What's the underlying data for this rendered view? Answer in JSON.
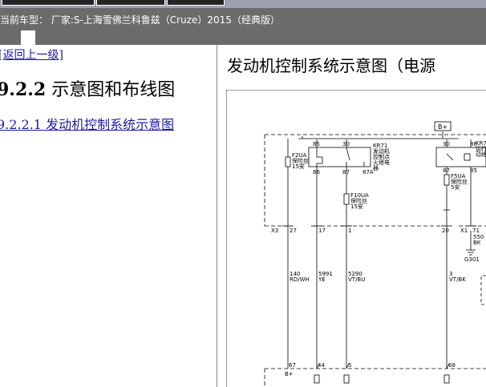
{
  "window": {
    "breadcrumb": "当前车型：  厂家:S-上海雪佛兰科鲁兹（Cruze）2015（经典版）"
  },
  "left": {
    "back_link": "[返回上一级]",
    "section_number": "9.2.2",
    "section_title": "示意图和布线图",
    "sub_link": "9.2.2.1 发动机控制系统示意图"
  },
  "doc": {
    "title": "发动机控制系统示意图（电源"
  },
  "diagram": {
    "bplus_top": "B+",
    "relay1": {
      "l1": "KR71",
      "l2": "发动机",
      "l3": "控制点",
      "l4": "火继电",
      "l5": "器"
    },
    "relay1_pins": {
      "p85": "85",
      "p30": "30",
      "p86": "86",
      "p87": "87",
      "p87a": "87A"
    },
    "fuse1": {
      "l1": "F2UA",
      "l2": "保险丝",
      "l3": "15安"
    },
    "fuse2": {
      "l1": "F10UA",
      "l2": "保险丝",
      "l3": "15安"
    },
    "fuse3": {
      "l1": "F5UA",
      "l2": "保险丝",
      "l3": "5安"
    },
    "relay2": {
      "l1": "KR7",
      "l2": "运行",
      "l3": "动继"
    },
    "relay2_pins": {
      "p30": "30",
      "p86": "86",
      "p87": "87",
      "p85": "85"
    },
    "conn_x3": "X3",
    "x3_pins": {
      "a": "27",
      "b": "17",
      "c": "1"
    },
    "conn_x1": "X1",
    "x1_pins": {
      "a": "20",
      "b": "71"
    },
    "wire_gnd": {
      "l1": "550",
      "l2": "BK"
    },
    "ground": "G301",
    "wire1": {
      "l1": "140",
      "l2": "RD/WH"
    },
    "wire2": {
      "l1": "5991",
      "l2": "YE"
    },
    "wire3": {
      "l1": "5290",
      "l2": "VT/BU"
    },
    "wire4": {
      "l1": "3",
      "l2": "VT/BK"
    },
    "bottom_pins": {
      "a": "67",
      "b": "44",
      "c": "5",
      "d": "68"
    },
    "bplus_bottom": "B+"
  }
}
